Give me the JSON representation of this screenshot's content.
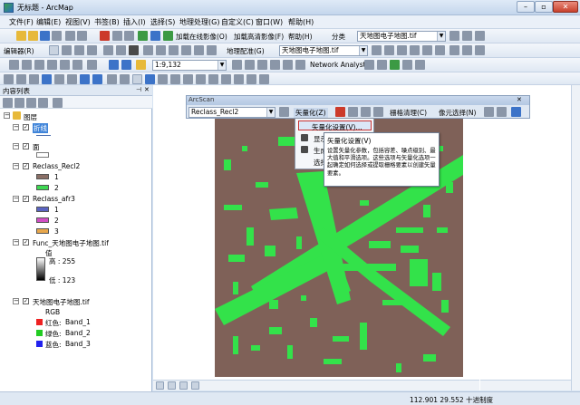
{
  "window": {
    "title": "无标题 - ArcMap"
  },
  "menubar": [
    {
      "label": "文件(F)"
    },
    {
      "label": "编辑(E)"
    },
    {
      "label": "视图(V)"
    },
    {
      "label": "书签(B)"
    },
    {
      "label": "插入(I)"
    },
    {
      "label": "选择(S)"
    },
    {
      "label": "地理处理(G)"
    },
    {
      "label": "自定义(C)"
    },
    {
      "label": "窗口(W)"
    },
    {
      "label": "帮助(H)"
    }
  ],
  "toolbar1": {
    "add_imagery": "加载在线影像(O)",
    "add_highdef": "加载高清影像(F)",
    "help": "帮助(H)",
    "classify": "分类",
    "raster_layer": "天地图电子地图.tif"
  },
  "toolbar2": {
    "editor": "编辑器(R)",
    "georef": "地理配准(G)",
    "georef_layer": "天地图电子地图.tif"
  },
  "toolbar3": {
    "scale": "1:9,132",
    "network_analyst": "Network Analyst"
  },
  "toc": {
    "title": "内容列表",
    "layers_root": "图层",
    "items": [
      {
        "label": "折线",
        "type": "line"
      },
      {
        "label": "面",
        "type": "poly"
      },
      {
        "label": "Reclass_Recl2"
      },
      {
        "label": "1"
      },
      {
        "label": "2"
      },
      {
        "label": "Reclass_afr3"
      },
      {
        "label": "1"
      },
      {
        "label": "2"
      },
      {
        "label": "3"
      },
      {
        "label": "Func_天地图电子地图.tif"
      },
      {
        "label": "值"
      },
      {
        "label": "高 : 255"
      },
      {
        "label": "低 : 123"
      },
      {
        "label": "天地图电子地图.tif"
      },
      {
        "label": "RGB"
      },
      {
        "label": "红色:",
        "band": "Band_1"
      },
      {
        "label": "绿色:",
        "band": "Band_2"
      },
      {
        "label": "蓝色:",
        "band": "Band_3"
      }
    ]
  },
  "arcscan": {
    "title": "ArcScan",
    "layer": "Reclass_Recl2",
    "vectorize": "矢量化(Z)",
    "raster_cleanup": "栅格清理(C)",
    "cell_select": "像元选择(N)",
    "menu_item": "矢量化设置(V)...",
    "menu_partial_1": "显示",
    "menu_partial_2": "生成",
    "menu_partial_3": "选择"
  },
  "tooltip": {
    "title": "矢量化设置(V)",
    "body": "设置矢量化参数，包括容差、噪点级别、最大值和平滑选项。这些选项与矢量化选项一起确定如何选择或提取栅格要素以创建矢量要素。"
  },
  "status": {
    "coords": "112.901  29.552 十进制度"
  },
  "colors": {
    "raster_bg": "#7f6158",
    "raster_fg": "#33e24a",
    "class_1": "#8a6f66",
    "class_2": "#3ed852"
  }
}
